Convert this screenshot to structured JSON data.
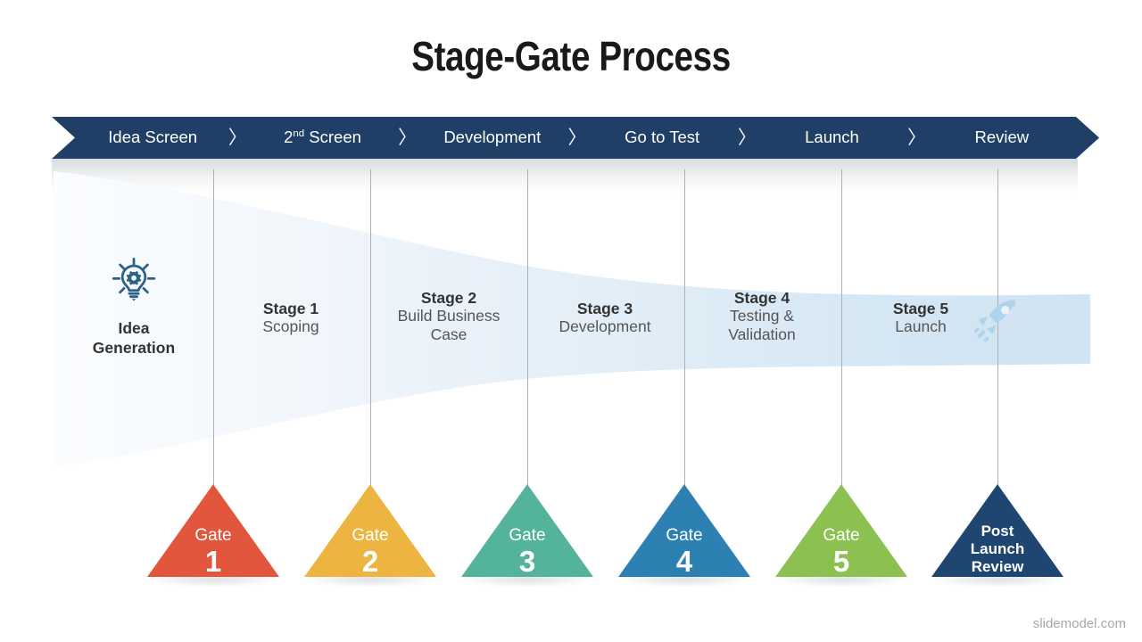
{
  "slide": {
    "title": "Stage-Gate Process",
    "watermark": "slidemodel.com"
  },
  "colors": {
    "navy": "#1f3f66",
    "funnel_light": "#f7fafd",
    "funnel_dark": "#cfe3f2",
    "icon_blue": "#2a6288",
    "rocket_blue": "#aed3ea",
    "stage_title": "#333333",
    "stage_sub": "#555555",
    "divider": "#b0b0b0",
    "watermark": "#a8a8a8"
  },
  "nav": {
    "separator_glyph": "〉",
    "items": [
      {
        "label": "Idea Screen",
        "sup": ""
      },
      {
        "label": "2",
        "sup": "nd",
        "suffix": " Screen"
      },
      {
        "label": "Development",
        "sup": ""
      },
      {
        "label": "Go to Test",
        "sup": ""
      },
      {
        "label": "Launch",
        "sup": ""
      },
      {
        "label": "Review",
        "sup": ""
      }
    ],
    "labels": {
      "item0": "Idea Screen",
      "item1_num": "2",
      "item1_sup": "nd",
      "item1_rest": " Screen",
      "item2": "Development",
      "item3": "Go to Test",
      "item4": "Launch",
      "item5": "Review"
    }
  },
  "idea": {
    "icon": "lightbulb-gear-icon",
    "line1": "Idea",
    "line2": "Generation"
  },
  "stages": [
    {
      "title": "Stage 1",
      "sub": "Scoping"
    },
    {
      "title": "Stage 2",
      "sub_line1": "Build Business",
      "sub_line2": "Case"
    },
    {
      "title": "Stage 3",
      "sub": "Development"
    },
    {
      "title": "Stage 4",
      "sub_line1": "Testing &",
      "sub_line2": "Validation"
    },
    {
      "title": "Stage 5",
      "sub": "Launch"
    }
  ],
  "rocket": {
    "icon": "rocket-icon"
  },
  "gates": [
    {
      "word": "Gate",
      "number": "1",
      "color": "#e1563c"
    },
    {
      "word": "Gate",
      "number": "2",
      "color": "#edb442"
    },
    {
      "word": "Gate",
      "number": "3",
      "color": "#54b39b"
    },
    {
      "word": "Gate",
      "number": "4",
      "color": "#2c81b2"
    },
    {
      "word": "Gate",
      "number": "5",
      "color": "#8cc152"
    },
    {
      "line1": "Post",
      "line2": "Launch",
      "line3": "Review",
      "color": "#1f4571"
    }
  ]
}
